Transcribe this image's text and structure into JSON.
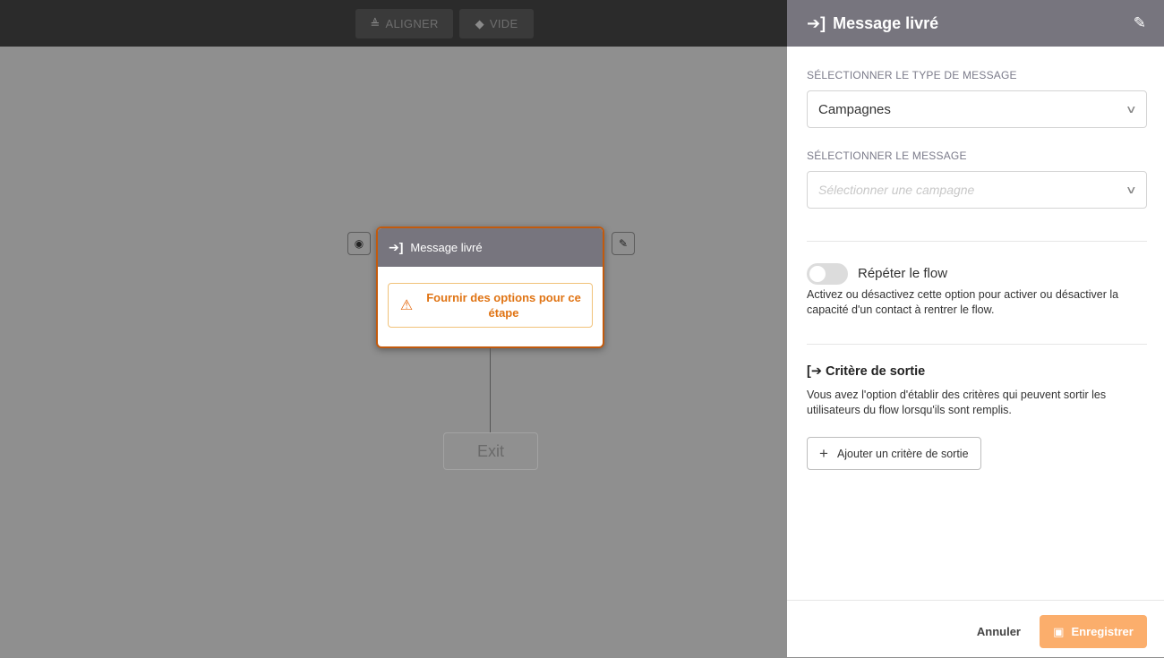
{
  "toolbar": {
    "align_label": "ALIGNER",
    "align_icon": "align-center-icon",
    "clear_label": "VIDE",
    "clear_icon": "eraser-icon"
  },
  "canvas": {
    "node": {
      "title": "Message livré",
      "icon": "sign-in-icon",
      "warning": "Fournir des options pour ce étape",
      "warning_icon": "warning-triangle-icon"
    },
    "exit_label": "Exit"
  },
  "panel": {
    "title": "Message livré",
    "message_type_label": "SÉLECTIONNER LE TYPE DE MESSAGE",
    "message_type_value": "Campagnes",
    "message_label": "SÉLECTIONNER LE MESSAGE",
    "message_placeholder": "Sélectionner une campagne",
    "repeat_label": "Répéter le flow",
    "repeat_enabled": false,
    "repeat_desc": "Activez ou désactivez cette option pour activer ou désactiver la capacité d'un contact à rentrer le flow.",
    "exit_title": "Critère de sortie",
    "exit_desc": "Vous avez l'option d'établir des critères qui peuvent sortir les utilisateurs du flow lorsqu'ils sont remplis.",
    "add_exit_label": "Ajouter un critère de sortie",
    "cancel_label": "Annuler",
    "save_label": "Enregistrer"
  },
  "colors": {
    "header_bg": "#77757e",
    "accent_orange": "#fbae6c",
    "warning_orange": "#e07414"
  }
}
